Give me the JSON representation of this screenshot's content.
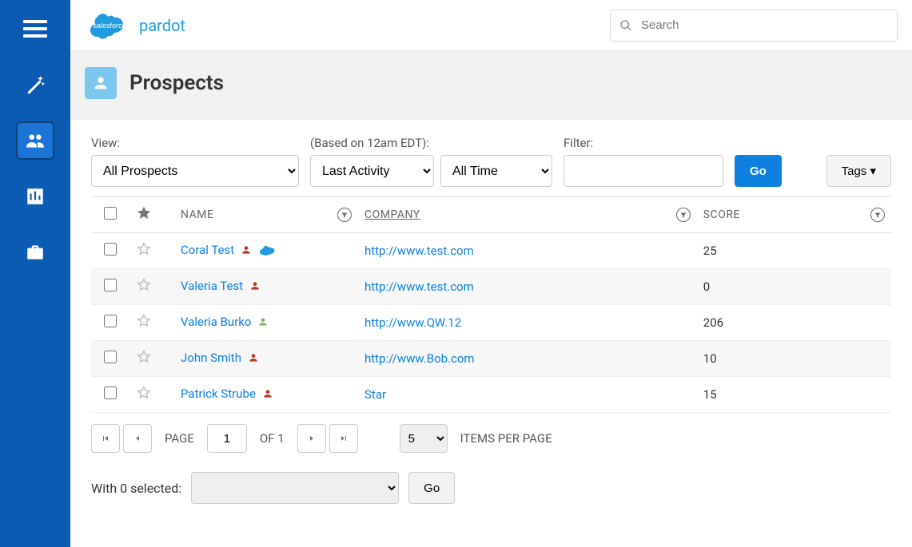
{
  "brand": {
    "name1": "salesforce",
    "name2": "pardot"
  },
  "search": {
    "placeholder": "Search"
  },
  "page": {
    "title": "Prospects"
  },
  "filters": {
    "view_label": "View:",
    "view_selected": "All Prospects",
    "activity_label": "(Based on 12am EDT):",
    "activity_selected": "Last Activity",
    "time_selected": "All Time",
    "filter_label": "Filter:",
    "go_button": "Go",
    "tags_button": "Tags"
  },
  "table": {
    "col_name": "NAME",
    "col_company": "COMPANY",
    "col_score": "SCORE",
    "rows": [
      {
        "name": "Coral Test",
        "icon_color": "red",
        "has_cloud": true,
        "company": "http://www.test.com",
        "score": "25"
      },
      {
        "name": "Valeria Test",
        "icon_color": "red",
        "has_cloud": false,
        "company": "http://www.test.com",
        "score": "0"
      },
      {
        "name": "Valeria Burko",
        "icon_color": "green",
        "has_cloud": false,
        "company": "http://www.QW.12",
        "score": "206"
      },
      {
        "name": "John Smith",
        "icon_color": "red",
        "has_cloud": false,
        "company": "http://www.Bob.com",
        "score": "10"
      },
      {
        "name": "Patrick Strube",
        "icon_color": "red",
        "has_cloud": false,
        "company": "Star",
        "score": "15"
      }
    ]
  },
  "pager": {
    "page_label": "PAGE",
    "of_label": "OF 1",
    "current_page": "1",
    "items_per_page": "5",
    "items_per_page_label": "ITEMS PER PAGE"
  },
  "bulk": {
    "with_selected_prefix": "With 0 selected:",
    "go_button": "Go"
  }
}
